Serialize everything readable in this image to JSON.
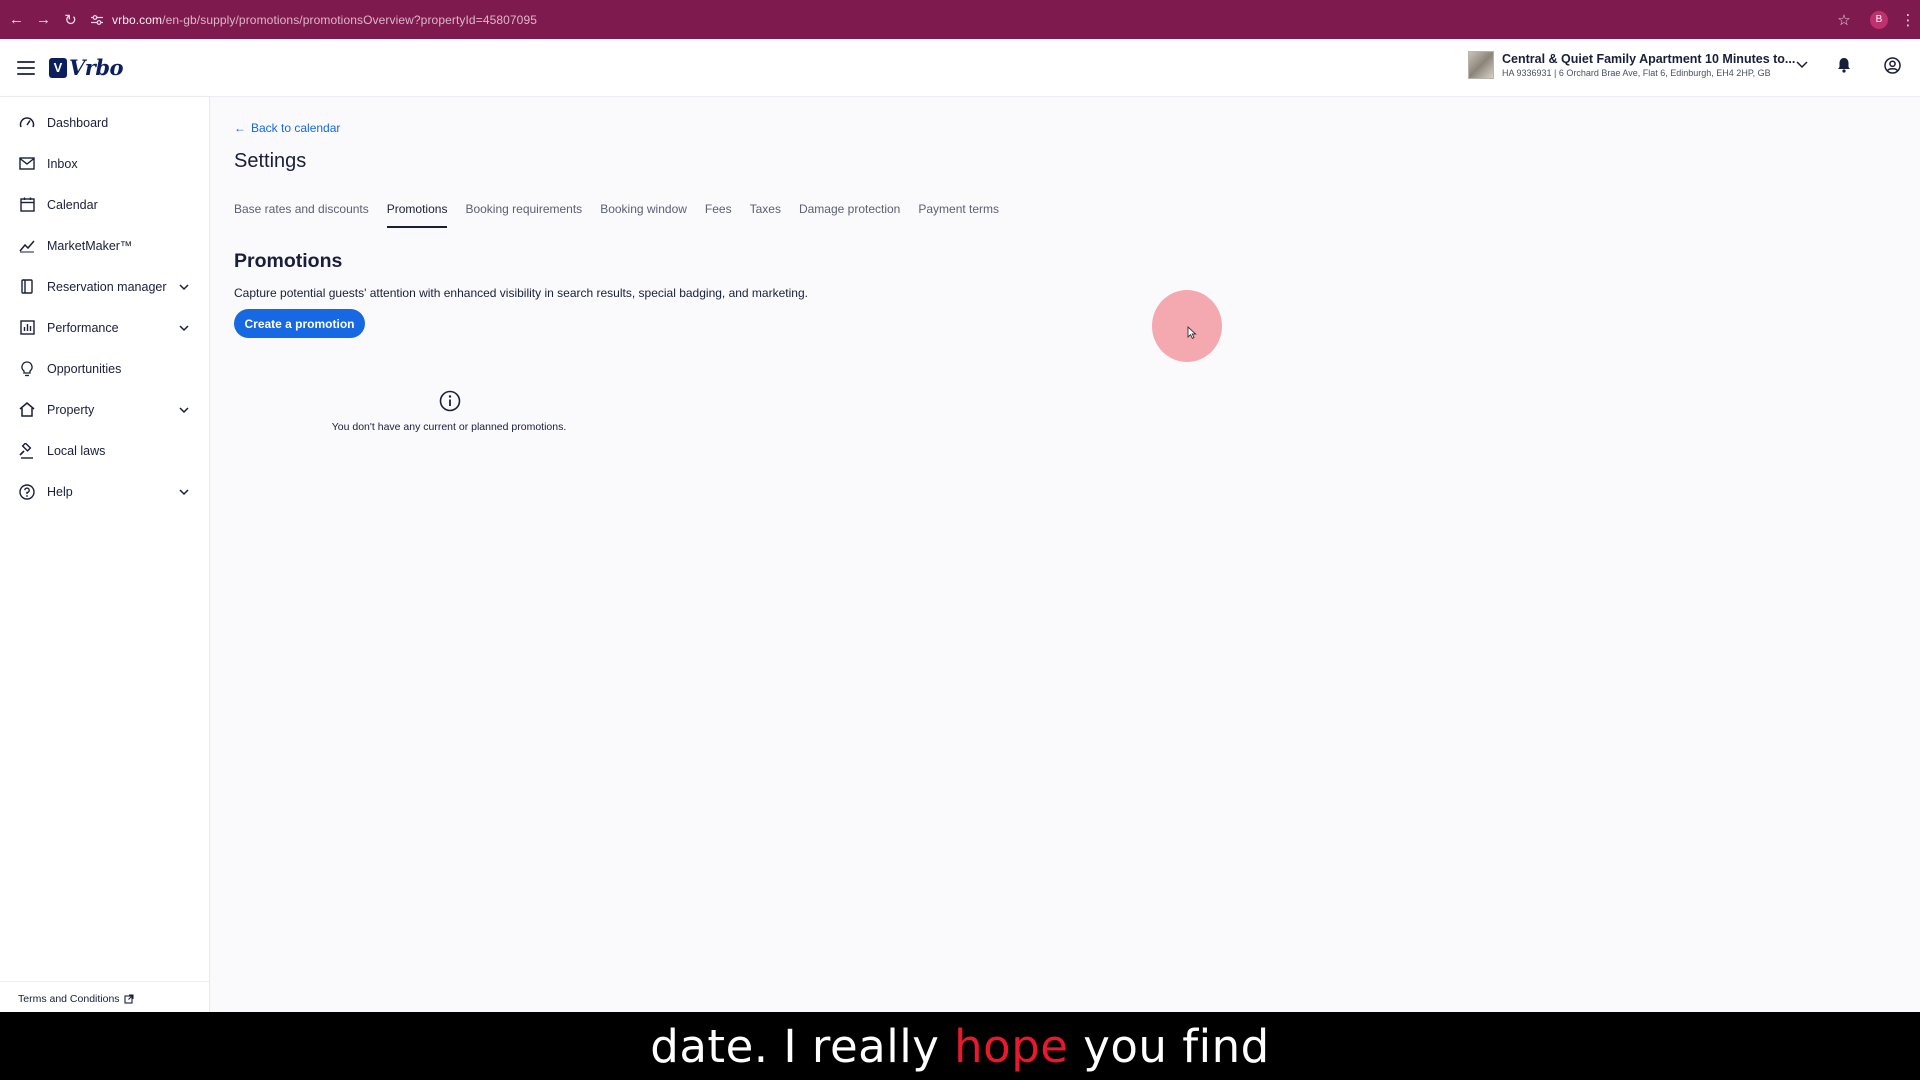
{
  "browser": {
    "url_host": "vrbo.com",
    "url_path": "/en-gb/supply/promotions/promotionsOverview?propertyId=45807095",
    "profile_initial": "B"
  },
  "topbar": {
    "logo_text": "Vrbo",
    "logo_mark": "V",
    "property_name": "Central & Quiet Family Apartment 10 Minutes to...",
    "property_address": "HA 9336931 | 6 Orchard Brae Ave, Flat 6, Edinburgh, EH4 2HP, GB"
  },
  "sidebar": {
    "items": [
      {
        "label": "Dashboard",
        "icon": "gauge-icon",
        "expandable": false
      },
      {
        "label": "Inbox",
        "icon": "mail-icon",
        "expandable": false
      },
      {
        "label": "Calendar",
        "icon": "calendar-icon",
        "expandable": false
      },
      {
        "label": "MarketMaker™",
        "icon": "trend-icon",
        "expandable": false
      },
      {
        "label": "Reservation manager",
        "icon": "bookmark-icon",
        "expandable": true
      },
      {
        "label": "Performance",
        "icon": "bar-chart-icon",
        "expandable": true
      },
      {
        "label": "Opportunities",
        "icon": "lightbulb-icon",
        "expandable": false
      },
      {
        "label": "Property",
        "icon": "home-icon",
        "expandable": true
      },
      {
        "label": "Local laws",
        "icon": "gavel-icon",
        "expandable": false
      },
      {
        "label": "Help",
        "icon": "help-icon",
        "expandable": true
      }
    ],
    "terms_label": "Terms and Conditions"
  },
  "main": {
    "back_label": "Back to calendar",
    "page_title": "Settings",
    "tabs": [
      {
        "label": "Base rates and discounts",
        "active": false
      },
      {
        "label": "Promotions",
        "active": true
      },
      {
        "label": "Booking requirements",
        "active": false
      },
      {
        "label": "Booking window",
        "active": false
      },
      {
        "label": "Fees",
        "active": false
      },
      {
        "label": "Taxes",
        "active": false
      },
      {
        "label": "Damage protection",
        "active": false
      },
      {
        "label": "Payment terms",
        "active": false
      }
    ],
    "section_title": "Promotions",
    "section_description": "Capture potential guests' attention with enhanced visibility in search results, special badging, and marketing.",
    "create_button_label": "Create a promotion",
    "empty_message": "You don't have any current or planned promotions."
  },
  "caption": {
    "before": "date. I really ",
    "highlight": "hope",
    "after": " you find"
  },
  "colors": {
    "browser_chrome": "#7e1a4e",
    "accent_blue": "#1668e3",
    "text_dark": "#191e3b",
    "caption_highlight": "#e8182d"
  }
}
